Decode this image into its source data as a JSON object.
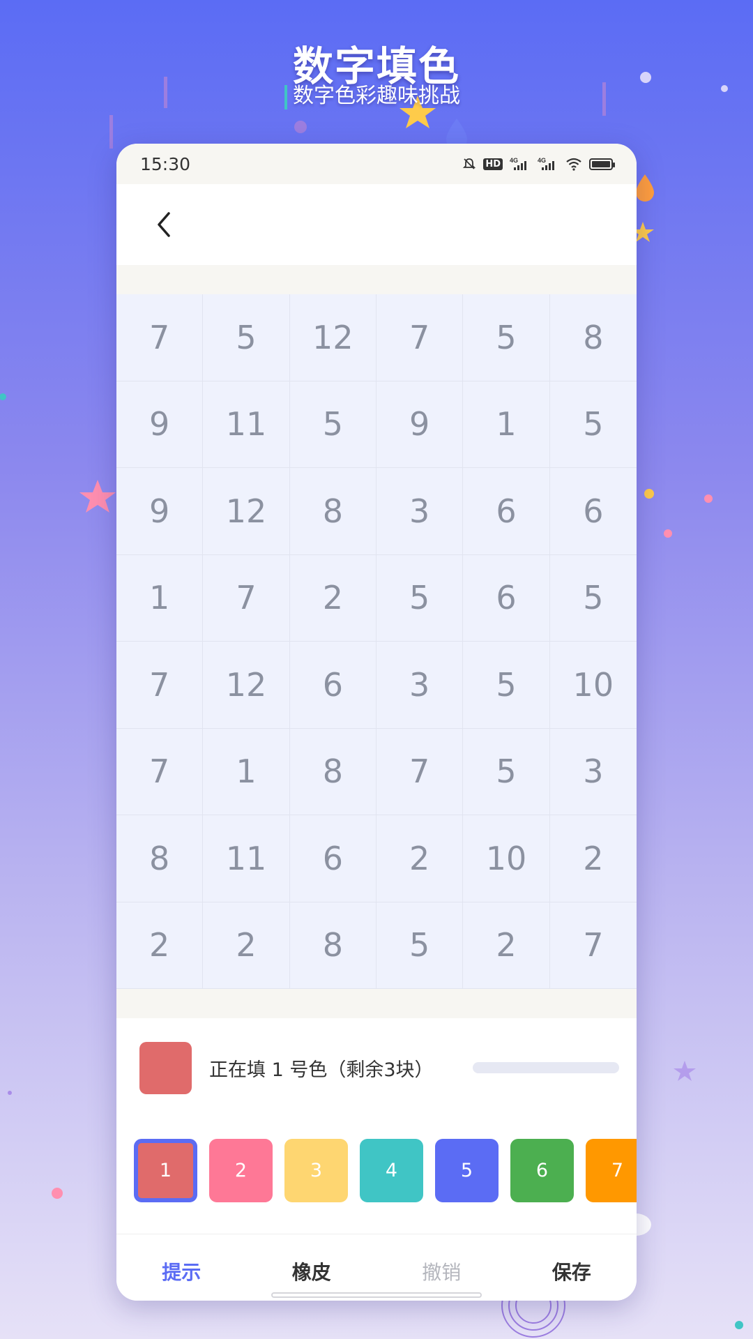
{
  "banner": {
    "title": "数字填色",
    "subtitle": "数字色彩趣味挑战"
  },
  "status_bar": {
    "time": "15:30",
    "icons": [
      "bell-off-icon",
      "hd-icon",
      "signal-4g-icon",
      "signal-4g-icon",
      "wifi-icon",
      "battery-icon"
    ],
    "hd_label": "HD",
    "net_label": "4G"
  },
  "nav": {
    "back_icon": "chevron-left-icon"
  },
  "grid": {
    "columns": 6,
    "rows": [
      [
        "7",
        "5",
        "12",
        "7",
        "5",
        "8"
      ],
      [
        "9",
        "11",
        "5",
        "9",
        "1",
        "5"
      ],
      [
        "9",
        "12",
        "8",
        "3",
        "6",
        "6"
      ],
      [
        "1",
        "7",
        "2",
        "5",
        "6",
        "5"
      ],
      [
        "7",
        "12",
        "6",
        "3",
        "5",
        "10"
      ],
      [
        "7",
        "1",
        "8",
        "7",
        "5",
        "3"
      ],
      [
        "8",
        "11",
        "6",
        "2",
        "10",
        "2"
      ],
      [
        "2",
        "2",
        "8",
        "5",
        "2",
        "7"
      ]
    ]
  },
  "current": {
    "label": "正在填 1 号色（剩余3块）",
    "color": "#e06b6b",
    "progress": 0
  },
  "palette": [
    {
      "label": "1",
      "color": "#e06b6b",
      "selected": true
    },
    {
      "label": "2",
      "color": "#fe7896",
      "selected": false
    },
    {
      "label": "3",
      "color": "#fed671",
      "selected": false
    },
    {
      "label": "4",
      "color": "#40c5c5",
      "selected": false
    },
    {
      "label": "5",
      "color": "#5b6cf4",
      "selected": false
    },
    {
      "label": "6",
      "color": "#4caf50",
      "selected": false
    },
    {
      "label": "7",
      "color": "#ff9800",
      "selected": false
    }
  ],
  "toolbar": {
    "hint": "提示",
    "eraser": "橡皮",
    "undo": "撤销",
    "save": "保存"
  },
  "colors": {
    "accent": "#5b6cf4",
    "grid_bg": "#eff2fd",
    "grid_text": "#8b91a0"
  }
}
